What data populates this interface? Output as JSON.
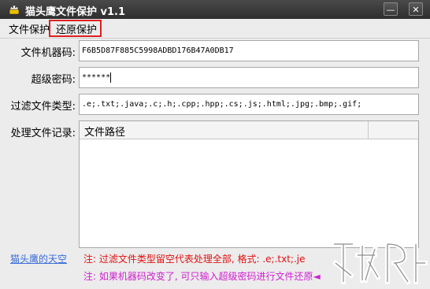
{
  "window": {
    "title": "猫头鹰文件保护 v1.1"
  },
  "titlebar_buttons": {
    "minimize": "—",
    "close": "✕"
  },
  "menu": {
    "items": [
      "文件保护",
      "还原保护"
    ]
  },
  "form": {
    "machine_code_label": "文件机器码:",
    "machine_code_value": "F6B5D87F885C5998ADBD176B47A0DB17",
    "super_password_label": "超级密码:",
    "super_password_value": "******",
    "filter_label": "过滤文件类型:",
    "filter_value": ".e;.txt;.java;.c;.h;.cpp;.hpp;.cs;.js;.html;.jpg;.bmp;.gif;",
    "records_label": "处理文件记录:"
  },
  "table": {
    "columns": [
      "文件路径"
    ],
    "rows": []
  },
  "footer": {
    "link_text": "猫头鹰的天空",
    "note1": "注: 过滤文件类型留空代表处理全部, 格式: .e;.txt;.je",
    "note2": "注: 如果机器码改变了, 可只输入超级密码进行文件还原◄",
    "note1_color": "#e01010",
    "note2_color": "#d020d0"
  },
  "icons": {
    "app": "owl-lock-icon",
    "watermark": "site-watermark-logo"
  },
  "colors": {
    "titlebar": "#2e2e2e",
    "highlight": "#e02020",
    "link": "#3a6dd8"
  }
}
